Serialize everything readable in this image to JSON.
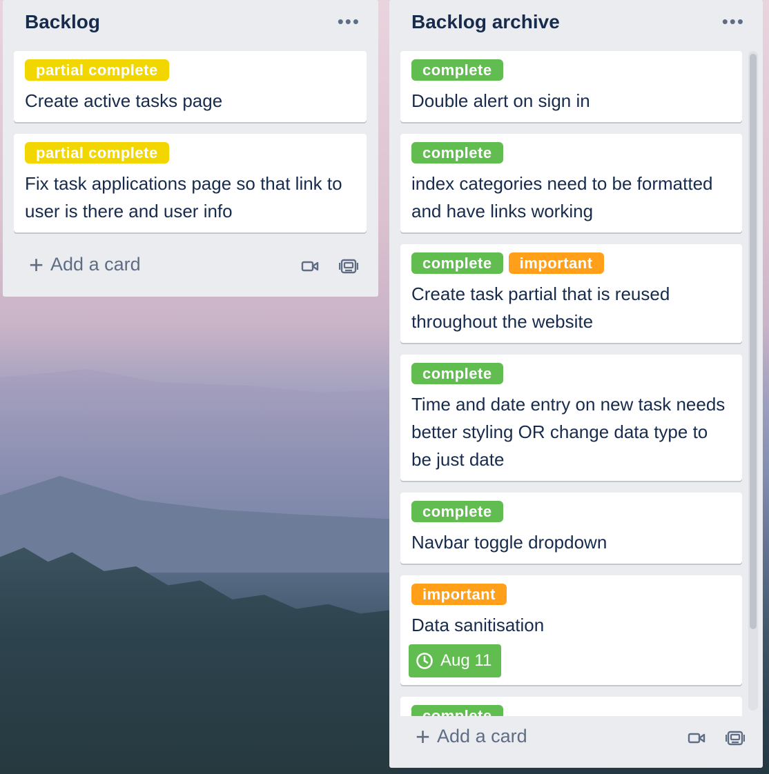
{
  "lists": {
    "left": {
      "title": "Backlog",
      "cards": [
        {
          "labels": [
            {
              "text": "partial complete",
              "color": "#f2d600"
            }
          ],
          "title": "Create active tasks page"
        },
        {
          "labels": [
            {
              "text": "partial complete",
              "color": "#f2d600"
            }
          ],
          "title": "Fix task applications page so that link to user is there and user info"
        }
      ],
      "add_card_label": "Add a card"
    },
    "right": {
      "title": "Backlog archive",
      "cards": [
        {
          "labels": [
            {
              "text": "complete",
              "color": "#61bd4f"
            }
          ],
          "title": "Double alert on sign in"
        },
        {
          "labels": [
            {
              "text": "complete",
              "color": "#61bd4f"
            }
          ],
          "title": "index categories need to be formatted and have links working"
        },
        {
          "labels": [
            {
              "text": "complete",
              "color": "#61bd4f"
            },
            {
              "text": "important",
              "color": "#ff9f1a"
            }
          ],
          "title": "Create task partial that is reused throughout the website"
        },
        {
          "labels": [
            {
              "text": "complete",
              "color": "#61bd4f"
            }
          ],
          "title": "Time and date entry on new task needs better styling OR change data type to be just date"
        },
        {
          "labels": [
            {
              "text": "complete",
              "color": "#61bd4f"
            }
          ],
          "title": "Navbar toggle dropdown"
        },
        {
          "labels": [
            {
              "text": "important",
              "color": "#ff9f1a"
            }
          ],
          "title": "Data sanitisation",
          "due": "Aug 11"
        },
        {
          "labels": [
            {
              "text": "complete",
              "color": "#61bd4f"
            }
          ],
          "title": ""
        }
      ],
      "add_card_label": "Add a card"
    }
  },
  "icons": [
    "more-icon",
    "plus-icon",
    "video-icon",
    "template-icon",
    "clock-icon"
  ],
  "colors": {
    "list_bg": "#ebecf0",
    "text": "#172b4d",
    "muted": "#5e6c84",
    "green": "#61bd4f",
    "yellow": "#f2d600",
    "orange": "#ff9f1a"
  }
}
